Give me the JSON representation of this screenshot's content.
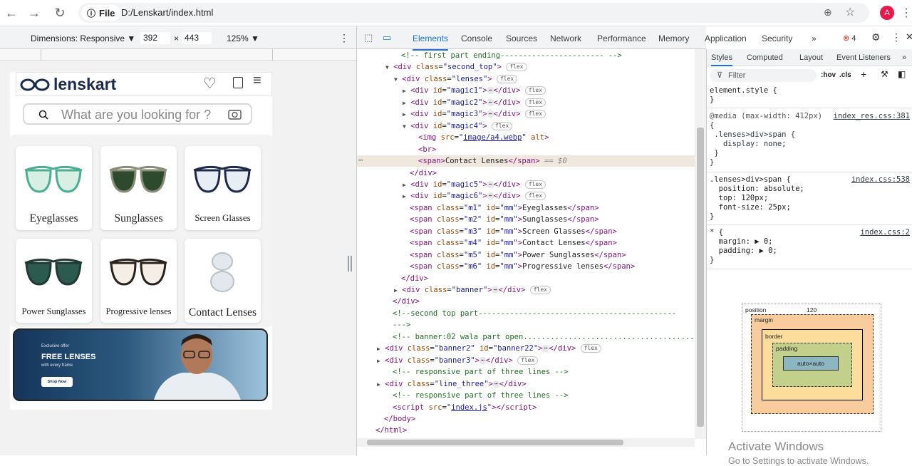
{
  "browser": {
    "file_chip": "File",
    "url": "D:/Lenskart/index.html",
    "avatar_letter": "A"
  },
  "device_toolbar": {
    "dimensions_label": "Dimensions: Responsive ▼",
    "width": "392",
    "times": "×",
    "height": "443",
    "zoom": "125% ▼"
  },
  "site": {
    "logo_text": "lenskart",
    "search_placeholder": "What are you looking for ?",
    "categories": [
      {
        "label": "Eyeglasses",
        "frame_color": "#4bae93",
        "lens_color": "#d8efe6"
      },
      {
        "label": "Sunglasses",
        "frame_color": "#8b8b7a",
        "lens_color": "#2e4a2e"
      },
      {
        "label": "Screen Glasses",
        "frame_color": "#1e2a4a",
        "lens_color": "#e8eef5"
      },
      {
        "label": "Power Sunglasses",
        "frame_color": "#1f3a33",
        "lens_color": "#2c5a4e"
      },
      {
        "label": "Progressive lenses",
        "frame_color": "#2a211c",
        "lens_color": "#f5eee6"
      },
      {
        "label": "Contact Lenses",
        "frame_color": "#b8c2cc",
        "lens_color": "#e2e8ee"
      }
    ],
    "banner": {
      "kicker": "Exclusive offer",
      "headline": "FREE LENSES",
      "sub": "with every frame",
      "cta": "Shop Now"
    }
  },
  "devtools": {
    "tabs": [
      "Elements",
      "Console",
      "Sources",
      "Network",
      "Performance",
      "Memory",
      "Application",
      "Security",
      "»"
    ],
    "error_count": "4",
    "dom_lines": [
      {
        "indent": 2,
        "arrow": "",
        "html": "<span class='cmt'>&lt;!-- first part ending----------------------- --&gt;</span>"
      },
      {
        "indent": 1,
        "arrow": "▼",
        "html": "<span class='tag'>&lt;div</span> <span class='attr'>class</span>=<span class='val'>\"second_top\"</span><span class='tag'>&gt;</span> <span class='flex'>flex</span>"
      },
      {
        "indent": 2,
        "arrow": "▼",
        "html": "<span class='tag'>&lt;div</span> <span class='attr'>class</span>=<span class='val'>\"lenses\"</span><span class='tag'>&gt;</span> <span class='flex'>flex</span>"
      },
      {
        "indent": 3,
        "arrow": "▶",
        "html": "<span class='tag'>&lt;div</span> <span class='attr'>id</span>=<span class='val'>\"magic1\"</span><span class='tag'>&gt;</span><span class='ell'>⋯</span><span class='tag'>&lt;/div&gt;</span> <span class='flex'>flex</span>"
      },
      {
        "indent": 3,
        "arrow": "▶",
        "html": "<span class='tag'>&lt;div</span> <span class='attr'>id</span>=<span class='val'>\"magic2\"</span><span class='tag'>&gt;</span><span class='ell'>⋯</span><span class='tag'>&lt;/div&gt;</span> <span class='flex'>flex</span>"
      },
      {
        "indent": 3,
        "arrow": "▶",
        "html": "<span class='tag'>&lt;div</span> <span class='attr'>id</span>=<span class='val'>\"magic3\"</span><span class='tag'>&gt;</span><span class='ell'>⋯</span><span class='tag'>&lt;/div&gt;</span> <span class='flex'>flex</span>"
      },
      {
        "indent": 3,
        "arrow": "▼",
        "html": "<span class='tag'>&lt;div</span> <span class='attr'>id</span>=<span class='val'>\"magic4\"</span><span class='tag'>&gt;</span> <span class='flex'>flex</span>"
      },
      {
        "indent": 4,
        "arrow": "",
        "html": "<span class='tag'>&lt;img</span> <span class='attr'>src</span>=<span class='val'>\"<u>image/a4.webp</u>\"</span> <span class='attr'>alt</span><span class='tag'>&gt;</span>"
      },
      {
        "indent": 4,
        "arrow": "",
        "html": "<span class='tag'>&lt;br&gt;</span>"
      },
      {
        "indent": 4,
        "arrow": "",
        "html": "<span class='tag'>&lt;span&gt;</span>Contact Lenses<span class='tag'>&lt;/span&gt;</span> <i style='color:#888'>== $0</i>"
      },
      {
        "indent": 3,
        "arrow": "",
        "html": "<span class='tag'>&lt;/div&gt;</span>"
      },
      {
        "indent": 3,
        "arrow": "▶",
        "html": "<span class='tag'>&lt;div</span> <span class='attr'>id</span>=<span class='val'>\"magic5\"</span><span class='tag'>&gt;</span><span class='ell'>⋯</span><span class='tag'>&lt;/div&gt;</span> <span class='flex'>flex</span>"
      },
      {
        "indent": 3,
        "arrow": "▶",
        "html": "<span class='tag'>&lt;div</span> <span class='attr'>id</span>=<span class='val'>\"magic6\"</span><span class='tag'>&gt;</span><span class='ell'>⋯</span><span class='tag'>&lt;/div&gt;</span> <span class='flex'>flex</span>"
      },
      {
        "indent": 3,
        "arrow": "",
        "html": "<span class='tag'>&lt;span</span> <span class='attr'>class</span>=<span class='val'>\"m1\"</span> <span class='attr'>id</span>=<span class='val'>\"mm\"</span><span class='tag'>&gt;</span>Eyeglasses<span class='tag'>&lt;/span&gt;</span>"
      },
      {
        "indent": 3,
        "arrow": "",
        "html": "<span class='tag'>&lt;span</span> <span class='attr'>class</span>=<span class='val'>\"m2\"</span> <span class='attr'>id</span>=<span class='val'>\"mm\"</span><span class='tag'>&gt;</span>Sunglasses<span class='tag'>&lt;/span&gt;</span>"
      },
      {
        "indent": 3,
        "arrow": "",
        "html": "<span class='tag'>&lt;span</span> <span class='attr'>class</span>=<span class='val'>\"m3\"</span> <span class='attr'>id</span>=<span class='val'>\"mm\"</span><span class='tag'>&gt;</span>Screen Glasses<span class='tag'>&lt;/span&gt;</span>"
      },
      {
        "indent": 3,
        "arrow": "",
        "html": "<span class='tag'>&lt;span</span> <span class='attr'>class</span>=<span class='val'>\"m4\"</span> <span class='attr'>id</span>=<span class='val'>\"mm\"</span><span class='tag'>&gt;</span>Contact Lenses<span class='tag'>&lt;/span&gt;</span>"
      },
      {
        "indent": 3,
        "arrow": "",
        "html": "<span class='tag'>&lt;span</span> <span class='attr'>class</span>=<span class='val'>\"m5\"</span> <span class='attr'>id</span>=<span class='val'>\"mm\"</span><span class='tag'>&gt;</span>Power Sunglasses<span class='tag'>&lt;/span&gt;</span>"
      },
      {
        "indent": 3,
        "arrow": "",
        "html": "<span class='tag'>&lt;span</span> <span class='attr'>class</span>=<span class='val'>\"m6\"</span> <span class='attr'>id</span>=<span class='val'>\"mm\"</span><span class='tag'>&gt;</span>Progressive lenses<span class='tag'>&lt;/span&gt;</span>"
      },
      {
        "indent": 2,
        "arrow": "",
        "html": "<span class='tag'>&lt;/div&gt;</span>"
      },
      {
        "indent": 2,
        "arrow": "▶",
        "html": "<span class='tag'>&lt;div</span> <span class='attr'>class</span>=<span class='val'>\"banner\"</span><span class='tag'>&gt;</span><span class='ell'>⋯</span><span class='tag'>&lt;/div&gt;</span> <span class='flex'>flex</span>"
      },
      {
        "indent": 1,
        "arrow": "",
        "html": "<span class='tag'>&lt;/div&gt;</span>"
      },
      {
        "indent": 1,
        "arrow": "",
        "html": "<span class='cmt'>&lt;!--second top part--------------------------------------------</span>"
      },
      {
        "indent": 1,
        "arrow": "",
        "html": "<span class='cmt'>---&gt;</span>"
      },
      {
        "indent": 1,
        "arrow": "",
        "html": "<span class='cmt'>&lt;!-- banner:02 wala part open......................................</span>"
      },
      {
        "indent": 0,
        "arrow": "▶",
        "html": "<span class='tag'>&lt;div</span> <span class='attr'>class</span>=<span class='val'>\"banner2\"</span> <span class='attr'>id</span>=<span class='val'>\"banner22\"</span><span class='tag'>&gt;</span><span class='ell'>⋯</span><span class='tag'>&lt;/div&gt;</span> <span class='flex'>flex</span>"
      },
      {
        "indent": 0,
        "arrow": "▶",
        "html": "<span class='tag'>&lt;div</span> <span class='attr'>class</span>=<span class='val'>\"banner3\"</span><span class='tag'>&gt;</span><span class='ell'>⋯</span><span class='tag'>&lt;/div&gt;</span> <span class='flex'>flex</span>"
      },
      {
        "indent": 1,
        "arrow": "",
        "html": "<span class='cmt'>&lt;!-- responsive part of three lines --&gt;</span>"
      },
      {
        "indent": 0,
        "arrow": "▶",
        "html": "<span class='tag'>&lt;div</span> <span class='attr'>class</span>=<span class='val'>\"line_three\"</span><span class='tag'>&gt;</span><span class='ell'>⋯</span><span class='tag'>&lt;/div&gt;</span>"
      },
      {
        "indent": 1,
        "arrow": "",
        "html": "<span class='cmt'>&lt;!-- responsive part of three lines --&gt;</span>"
      },
      {
        "indent": 1,
        "arrow": "",
        "html": "<span class='tag'>&lt;script</span> <span class='attr'>src</span>=<span class='val'>\"<u>index.js</u>\"</span><span class='tag'>&gt;&lt;/script&gt;</span>"
      },
      {
        "indent": 0,
        "arrow": "",
        "html": "<span class='tag'>&lt;/body&gt;</span>"
      },
      {
        "indent": -1,
        "arrow": "",
        "html": "<span class='tag'>&lt;/html&gt;</span>"
      }
    ],
    "styles_tabs": [
      "Styles",
      "Computed",
      "Layout",
      "Event Listeners",
      "»"
    ],
    "filter_placeholder": "Filter",
    "hov": ":hov",
    "cls": ".cls",
    "rules": {
      "element_style": "element.style {\n}",
      "media_head": "@media (max-width: 412px)",
      "media_src": "index_res.css:381",
      "media_body": "{\n .lenses>div>span {\n   display: none;\n }\n}",
      "rule2_src": "index.css:538",
      "rule2": ".lenses>div>span {\n  position: absolute;\n  top: 120px;\n  font-size: 25px;\n}",
      "rule3_src": "index.css:2",
      "rule3": "* {\n  margin: ▶ 0;\n  padding: ▶ 0;\n}"
    },
    "box_model": {
      "position_label": "position",
      "position_value": "120",
      "margin_label": "margin",
      "border_label": "border",
      "padding_label": "padding",
      "content": "auto×auto",
      "dash": "–"
    },
    "watermark_title": "Activate Windows",
    "watermark_sub": "Go to Settings to activate Windows."
  }
}
